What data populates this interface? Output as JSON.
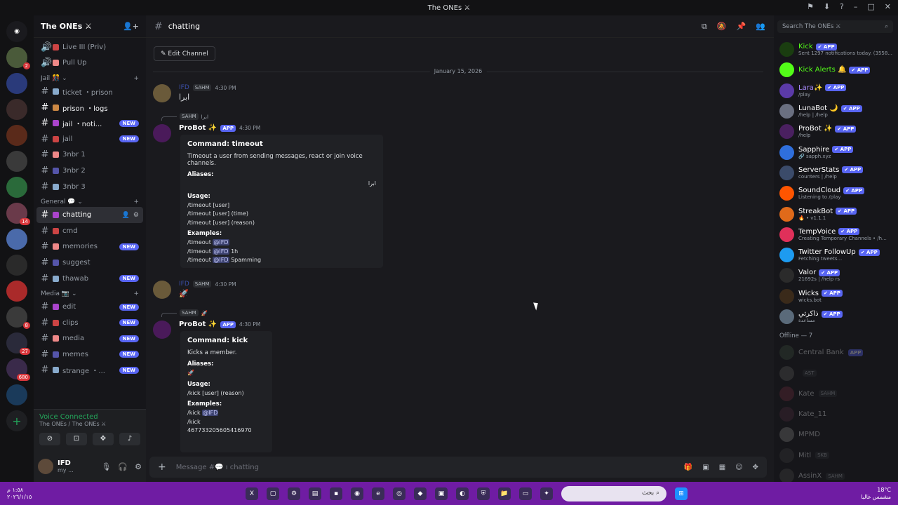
{
  "window": {
    "title": "The ONEs ⚔"
  },
  "server": {
    "name": "The ONEs ⚔"
  },
  "channels": [
    {
      "type": "channel",
      "name": "Live III (Priv)",
      "prefix": "🔊",
      "badge": ""
    },
    {
      "type": "channel",
      "name": "Pull Up",
      "prefix": "🔊",
      "badge": ""
    },
    {
      "type": "category",
      "name": "Jail 🎊 ⌄"
    },
    {
      "type": "channel",
      "name": "ticket ・prison",
      "prefix": "#",
      "badge": ""
    },
    {
      "type": "channel",
      "name": "prison ・logs",
      "prefix": "#",
      "badge": "",
      "bright": true
    },
    {
      "type": "channel",
      "name": "jail ・noti...",
      "prefix": "#",
      "badge": "NEW",
      "bright": true
    },
    {
      "type": "channel",
      "name": "jail",
      "prefix": "#",
      "badge": "NEW"
    },
    {
      "type": "channel",
      "name": "3nbr 1",
      "prefix": "#",
      "badge": ""
    },
    {
      "type": "channel",
      "name": "3nbr 2",
      "prefix": "#",
      "badge": ""
    },
    {
      "type": "channel",
      "name": "3nbr 3",
      "prefix": "#",
      "badge": ""
    },
    {
      "type": "category",
      "name": "General 💬 ⌄"
    },
    {
      "type": "channel",
      "name": "chatting",
      "prefix": "#",
      "badge": "",
      "active": true
    },
    {
      "type": "channel",
      "name": "cmd",
      "prefix": "#",
      "badge": ""
    },
    {
      "type": "channel",
      "name": "memories",
      "prefix": "#",
      "badge": "NEW"
    },
    {
      "type": "channel",
      "name": "suggest",
      "prefix": "#",
      "badge": ""
    },
    {
      "type": "channel",
      "name": "thawab",
      "prefix": "#",
      "badge": "NEW"
    },
    {
      "type": "category",
      "name": "Media 📷 ⌄"
    },
    {
      "type": "channel",
      "name": "edit",
      "prefix": "#",
      "badge": "NEW"
    },
    {
      "type": "channel",
      "name": "clips",
      "prefix": "#",
      "badge": "NEW"
    },
    {
      "type": "channel",
      "name": "media",
      "prefix": "#",
      "badge": "NEW"
    },
    {
      "type": "channel",
      "name": "memes",
      "prefix": "#",
      "badge": "NEW"
    },
    {
      "type": "channel",
      "name": "strange ・...",
      "prefix": "#",
      "badge": "NEW"
    }
  ],
  "voice": {
    "status": "Voice Connected",
    "location": "The ONEs / The ONEs ⚔"
  },
  "user": {
    "name": "IFD",
    "status": "my ..."
  },
  "header": {
    "channel": "chatting"
  },
  "edit_channel_label": "Edit Channel",
  "date_divider": "January 15, 2026",
  "messages": {
    "m1": {
      "user": "IFD",
      "tag": "SAHM",
      "time": "4:30 PM",
      "text": "ابرا"
    },
    "m2": {
      "reply_text": "ابرا",
      "bot": "ProBot ✨",
      "app": "APP",
      "time": "4:30 PM",
      "title": "Command: timeout",
      "desc": "Timeout a user from sending messages, react or join voice channels.",
      "aliases_label": "Aliases:",
      "alias": "ابرا",
      "usage_label": "Usage:",
      "usage": [
        "/timeout [user]",
        "/timeout [user] (time)",
        "/timeout [user] (reason)"
      ],
      "examples_label": "Examples:",
      "ex_prefix": "/timeout",
      "mention": "@IFD",
      "ex_suffix": [
        "",
        "1h",
        "Spamming"
      ]
    },
    "m3": {
      "user": "IFD",
      "tag": "SAHM",
      "time": "4:30 PM",
      "text": "🚀"
    },
    "m4": {
      "reply_text": "🚀",
      "bot": "ProBot ✨",
      "app": "APP",
      "time": "4:30 PM",
      "title": "Command: kick",
      "desc": "Kicks a member.",
      "aliases_label": "Aliases:",
      "alias": "🚀",
      "usage_label": "Usage:",
      "usage": "/kick [user] (reason)",
      "examples_label": "Examples:",
      "ex1_prefix": "/kick",
      "mention": "@IFD",
      "ex2": "/kick 467733205605416970"
    }
  },
  "composer": {
    "placeholder": "Message #💬 ı chatting"
  },
  "search": {
    "placeholder": "Search The ONEs ⚔"
  },
  "members": [
    {
      "name": "Kick",
      "sub": "Sent 1297 notifications today. (3558...",
      "color": "#53fc18",
      "bg": "#1a3d10"
    },
    {
      "name": "Kick Alerts 🔔",
      "sub": "",
      "color": "#53fc18",
      "bg": "#53fc18"
    },
    {
      "name": "Lara✨",
      "sub": "/play",
      "color": "#a98bff",
      "bg": "#5b3aa8"
    },
    {
      "name": "LunaBot 🌙",
      "sub": "/help | /help",
      "color": "#ffffff",
      "bg": "#6a6f80"
    },
    {
      "name": "ProBot ✨",
      "sub": "/help",
      "color": "#ffffff",
      "bg": "#4a2060"
    },
    {
      "name": "Sapphire",
      "sub": "🔗 sapph.xyz",
      "color": "#ffffff",
      "bg": "#2f6fdc"
    },
    {
      "name": "ServerStats",
      "sub": "counters | /help",
      "color": "#ffffff",
      "bg": "#3b4b6a"
    },
    {
      "name": "SoundCloud",
      "sub": "Listening to /play",
      "color": "#ffffff",
      "bg": "#ff5500"
    },
    {
      "name": "StreakBot",
      "sub": "🔥 • v1.1.1",
      "color": "#ffffff",
      "bg": "#e06a1a"
    },
    {
      "name": "TempVoice",
      "sub": "Creating Temporary Channels • /h...",
      "color": "#ffffff",
      "bg": "#e0305a"
    },
    {
      "name": "Twitter FollowUp",
      "sub": "Fetching tweets...",
      "color": "#ffffff",
      "bg": "#1d9bf0"
    },
    {
      "name": "Valor",
      "sub": "21692s | /help rs",
      "color": "#ffffff",
      "bg": "#2b2b2b"
    },
    {
      "name": "Wicks",
      "sub": "wicks.bot",
      "color": "#ffffff",
      "bg": "#3a2a1a"
    },
    {
      "name": "ذاكرتي",
      "sub": "مساعدة",
      "color": "#ffffff",
      "bg": "#5a6a7a"
    }
  ],
  "offline_header": "Offline — 7",
  "offline_members": [
    {
      "name": "Central Bank",
      "app": true,
      "bg": "#3a4a3a"
    },
    {
      "name": "",
      "app": false,
      "tag": "AST",
      "bg": "#555"
    },
    {
      "name": "Kate",
      "app": false,
      "tag": "SAHM",
      "bg": "#6a2a3a"
    },
    {
      "name": "Kate_11",
      "app": false,
      "tag": "",
      "bg": "#4a2a3a"
    },
    {
      "name": "MPMD",
      "app": false,
      "tag": "",
      "bg": "#777"
    },
    {
      "name": "Mitl",
      "app": false,
      "tag": "SKB",
      "bg": "#3a3a3a"
    },
    {
      "name": "AssinX",
      "app": false,
      "tag": "SAHM",
      "bg": "#444"
    }
  ],
  "taskbar": {
    "time_left": "١:٥٨ م\n٢٠٢٦/١/١٥",
    "search": "بحث",
    "temp": "18°C",
    "weather": "مشمس غالبا"
  }
}
